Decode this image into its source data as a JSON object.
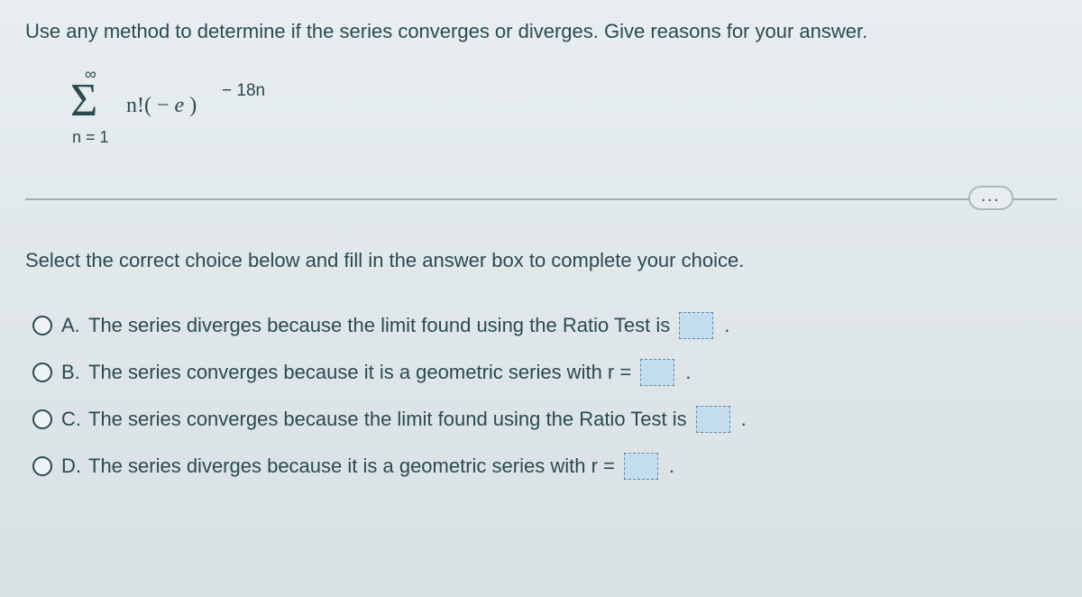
{
  "question": "Use any method to determine if the series converges or diverges. Give reasons for your answer.",
  "formula": {
    "upper": "∞",
    "sigma": "Σ",
    "lower": "n = 1",
    "term": "n!( − e )",
    "exponent": "− 18n"
  },
  "ellipsis": "...",
  "instruction": "Select the correct choice below and fill in the answer box to complete your choice.",
  "choices": {
    "a": {
      "letter": "A.",
      "text": "The series diverges because the limit found using the Ratio Test is",
      "trail": "."
    },
    "b": {
      "letter": "B.",
      "text": "The series converges because it is a geometric series with r =",
      "trail": "."
    },
    "c": {
      "letter": "C.",
      "text": "The series converges because the limit found using the Ratio Test is",
      "trail": "."
    },
    "d": {
      "letter": "D.",
      "text": "The series diverges because it is a geometric series with r =",
      "trail": "."
    }
  }
}
